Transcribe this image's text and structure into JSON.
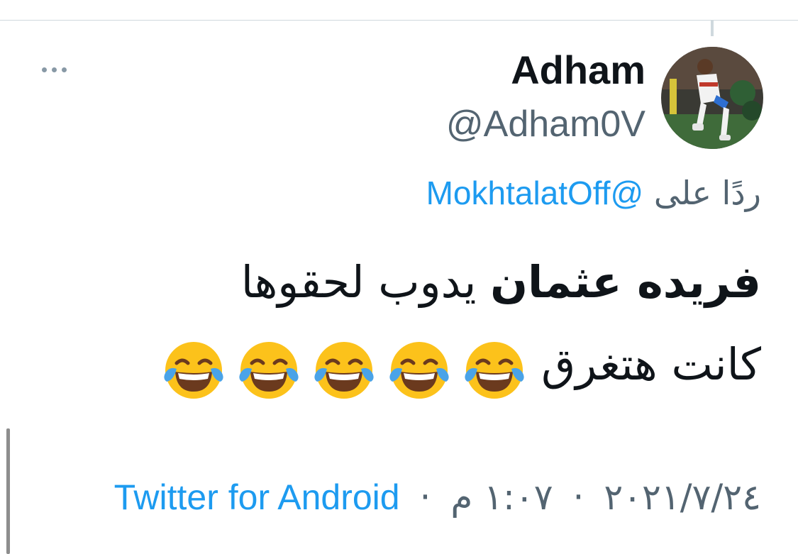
{
  "tweet": {
    "author": {
      "display_name": "Adham",
      "handle": "@Adham0V",
      "avatar_icon": "profile-photo"
    },
    "reply": {
      "prefix": "ردًا على",
      "mention": "@MokhtalatOff"
    },
    "text": {
      "part_bold": "فريده عثمان",
      "part_1": "يدوب لحقوها",
      "part_2": "كانت هتغرق"
    },
    "emojis": [
      "face-with-tears-of-joy",
      "face-with-tears-of-joy",
      "face-with-tears-of-joy",
      "face-with-tears-of-joy",
      "face-with-tears-of-joy"
    ],
    "meta": {
      "date": "٢٠٢١/٧/٢٤",
      "separator": "·",
      "time": "١:٠٧ م",
      "source": "Twitter for Android"
    },
    "more_icon": "more-dots"
  },
  "colors": {
    "link": "#1d9bf0",
    "secondary_text": "#536471",
    "primary_text": "#0f1419"
  }
}
